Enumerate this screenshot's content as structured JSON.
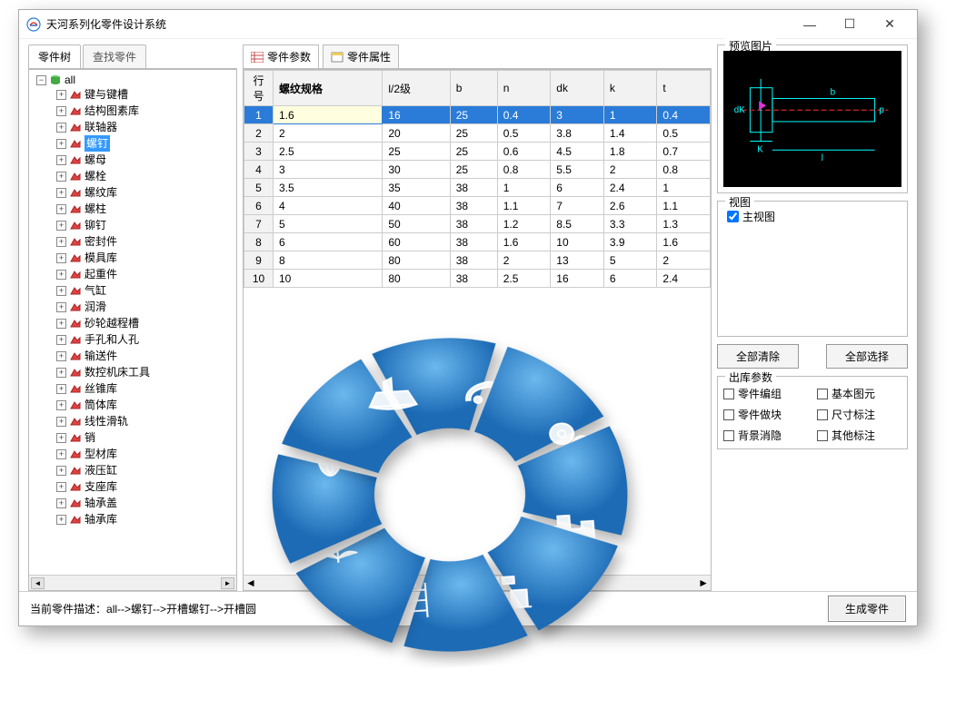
{
  "window": {
    "title": "天河系列化零件设计系统"
  },
  "leftPanel": {
    "tabs": [
      "零件树",
      "查找零件"
    ],
    "rootLabel": "all",
    "items": [
      "键与键槽",
      "结构图素库",
      "联轴器",
      "螺钉",
      "螺母",
      "螺栓",
      "螺纹库",
      "螺柱",
      "铆钉",
      "密封件",
      "模具库",
      "起重件",
      "气缸",
      "润滑",
      "砂轮越程槽",
      "手孔和人孔",
      "输送件",
      "数控机床工具",
      "丝锥库",
      "筒体库",
      "线性滑轨",
      "销",
      "型材库",
      "液压缸",
      "支座库",
      "轴承盖",
      "轴承库"
    ],
    "selectedIndex": 3
  },
  "centerPanel": {
    "tabs": [
      "零件参数",
      "零件属性"
    ],
    "columns": [
      "行号",
      "螺纹规格",
      "l/2级",
      "b",
      "n",
      "dk",
      "k",
      "t"
    ],
    "rows": [
      {
        "n": 1,
        "v": [
          "1.6",
          "16",
          "25",
          "0.4",
          "3",
          "1",
          "0.4"
        ]
      },
      {
        "n": 2,
        "v": [
          "2",
          "20",
          "25",
          "0.5",
          "3.8",
          "1.4",
          "0.5"
        ]
      },
      {
        "n": 3,
        "v": [
          "2.5",
          "25",
          "25",
          "0.6",
          "4.5",
          "1.8",
          "0.7"
        ]
      },
      {
        "n": 4,
        "v": [
          "3",
          "30",
          "25",
          "0.8",
          "5.5",
          "2",
          "0.8"
        ]
      },
      {
        "n": 5,
        "v": [
          "3.5",
          "35",
          "38",
          "1",
          "6",
          "2.4",
          "1"
        ]
      },
      {
        "n": 6,
        "v": [
          "4",
          "40",
          "38",
          "1.1",
          "7",
          "2.6",
          "1.1"
        ]
      },
      {
        "n": 7,
        "v": [
          "5",
          "50",
          "38",
          "1.2",
          "8.5",
          "3.3",
          "1.3"
        ]
      },
      {
        "n": 8,
        "v": [
          "6",
          "60",
          "38",
          "1.6",
          "10",
          "3.9",
          "1.6"
        ]
      },
      {
        "n": 9,
        "v": [
          "8",
          "80",
          "38",
          "2",
          "13",
          "5",
          "2"
        ]
      },
      {
        "n": 10,
        "v": [
          "10",
          "80",
          "38",
          "2.5",
          "16",
          "6",
          "2.4"
        ]
      }
    ],
    "selectedRow": 0
  },
  "rightPanel": {
    "previewTitle": "预览图片",
    "viewTitle": "视图",
    "viewItem": "主视图",
    "viewChecked": true,
    "btnClear": "全部清除",
    "btnSelect": "全部选择",
    "outTitle": "出库参数",
    "outParams": [
      "零件编组",
      "基本图元",
      "零件做块",
      "尺寸标注",
      "背景消隐",
      "其他标注"
    ],
    "previewLabels": {
      "dk": "dK",
      "b": "b",
      "K": "K",
      "l": "l",
      "p": "p"
    }
  },
  "status": {
    "label": "当前零件描述：",
    "path": "all-->螺钉-->开槽螺钉-->开槽圆",
    "genBtn": "生成零件"
  }
}
